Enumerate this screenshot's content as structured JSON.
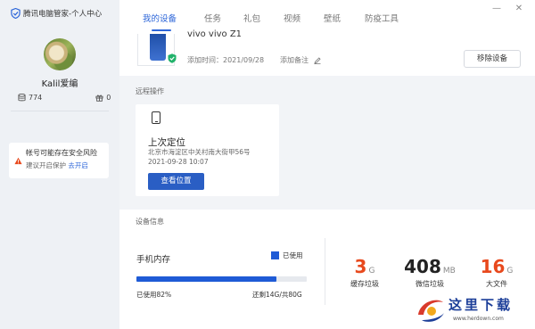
{
  "app": {
    "title": "腾讯电脑管家-个人中心"
  },
  "profile": {
    "username": "Kalil爱编",
    "storage_count": "774",
    "gift_count": "0"
  },
  "risk": {
    "title": "帐号可能存在安全风险",
    "subtitle": "建议开启保护",
    "link": "去开启"
  },
  "nav": {
    "tabs": [
      "我的设备",
      "任务",
      "礼包",
      "视频",
      "壁纸",
      "防疫工具"
    ],
    "active": 0
  },
  "window": {
    "minimize": "—",
    "close": "✕"
  },
  "device": {
    "name": "vivo vivo Z1",
    "added_label": "添加时间：2021/09/28",
    "add_note": "添加备注",
    "remove_button": "移除设备"
  },
  "remote": {
    "section_label": "远程操作",
    "locate_title": "上次定位",
    "address": "北京市海淀区中关村南大街甲56号",
    "time": "2021-09-28 10:07",
    "view_button": "查看位置"
  },
  "device_info": {
    "section_label": "设备信息",
    "memory_title": "手机内存",
    "legend": "已使用",
    "used_percent": 82,
    "used_label": "已使用82%",
    "remaining_label": "还剩14G/共80G",
    "metrics": [
      {
        "value": "3",
        "unit": "G",
        "label": "缓存垃圾",
        "color": "#e8491d"
      },
      {
        "value": "408",
        "unit": "MB",
        "label": "微信垃圾",
        "color": "#222222"
      },
      {
        "value": "16",
        "unit": "G",
        "label": "大文件",
        "color": "#e8491d"
      }
    ]
  },
  "watermark": {
    "text": "这里下载",
    "url": "www.herdown.com"
  },
  "colors": {
    "accent": "#2d66d9",
    "warning": "#e8491d",
    "bar": "#1f5bd6"
  }
}
